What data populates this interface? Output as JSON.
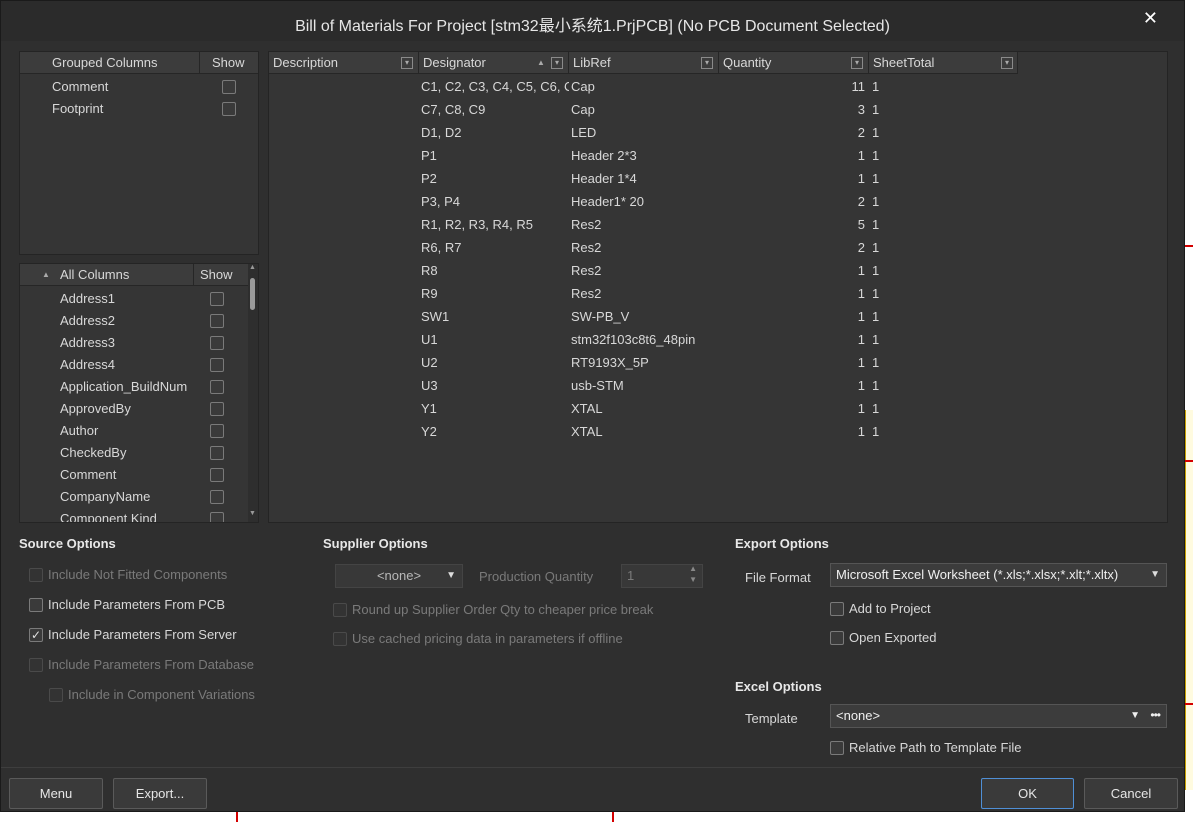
{
  "dialog": {
    "title": "Bill of Materials For Project [stm32最小系统1.PrjPCB] (No PCB Document Selected)",
    "close_glyph": "✕"
  },
  "grouped_columns": {
    "header": {
      "name": "Grouped Columns",
      "show": "Show"
    },
    "items": [
      {
        "label": "Comment",
        "checked": false
      },
      {
        "label": "Footprint",
        "checked": false
      }
    ]
  },
  "all_columns": {
    "header": {
      "name": "All Columns",
      "show": "Show"
    },
    "items": [
      {
        "label": "Address1",
        "checked": false
      },
      {
        "label": "Address2",
        "checked": false
      },
      {
        "label": "Address3",
        "checked": false
      },
      {
        "label": "Address4",
        "checked": false
      },
      {
        "label": "Application_BuildNum",
        "checked": false
      },
      {
        "label": "ApprovedBy",
        "checked": false
      },
      {
        "label": "Author",
        "checked": false
      },
      {
        "label": "CheckedBy",
        "checked": false
      },
      {
        "label": "Comment",
        "checked": false
      },
      {
        "label": "CompanyName",
        "checked": false
      },
      {
        "label": "Component Kind",
        "checked": false
      }
    ]
  },
  "bom_grid": {
    "columns": [
      "Description",
      "Designator",
      "LibRef",
      "Quantity",
      "SheetTotal"
    ],
    "rows": [
      {
        "description": "",
        "designator": "C1, C2, C3, C4, C5, C6, C",
        "libref": "Cap",
        "quantity": "11",
        "sheettotal": "1"
      },
      {
        "description": "",
        "designator": "C7, C8, C9",
        "libref": "Cap",
        "quantity": "3",
        "sheettotal": "1"
      },
      {
        "description": "",
        "designator": "D1, D2",
        "libref": "LED",
        "quantity": "2",
        "sheettotal": "1"
      },
      {
        "description": "",
        "designator": "P1",
        "libref": "Header 2*3",
        "quantity": "1",
        "sheettotal": "1"
      },
      {
        "description": "",
        "designator": "P2",
        "libref": "Header 1*4",
        "quantity": "1",
        "sheettotal": "1"
      },
      {
        "description": "",
        "designator": "P3, P4",
        "libref": "Header1* 20",
        "quantity": "2",
        "sheettotal": "1"
      },
      {
        "description": "",
        "designator": "R1, R2, R3, R4, R5",
        "libref": "Res2",
        "quantity": "5",
        "sheettotal": "1"
      },
      {
        "description": "",
        "designator": "R6, R7",
        "libref": "Res2",
        "quantity": "2",
        "sheettotal": "1"
      },
      {
        "description": "",
        "designator": "R8",
        "libref": "Res2",
        "quantity": "1",
        "sheettotal": "1"
      },
      {
        "description": "",
        "designator": "R9",
        "libref": "Res2",
        "quantity": "1",
        "sheettotal": "1"
      },
      {
        "description": "",
        "designator": "SW1",
        "libref": "SW-PB_V",
        "quantity": "1",
        "sheettotal": "1"
      },
      {
        "description": "",
        "designator": "U1",
        "libref": "stm32f103c8t6_48pin",
        "quantity": "1",
        "sheettotal": "1"
      },
      {
        "description": "",
        "designator": "U2",
        "libref": "RT9193X_5P",
        "quantity": "1",
        "sheettotal": "1"
      },
      {
        "description": "",
        "designator": "U3",
        "libref": "usb-STM",
        "quantity": "1",
        "sheettotal": "1"
      },
      {
        "description": "",
        "designator": "Y1",
        "libref": "XTAL",
        "quantity": "1",
        "sheettotal": "1"
      },
      {
        "description": "",
        "designator": "Y2",
        "libref": "XTAL",
        "quantity": "1",
        "sheettotal": "1"
      }
    ]
  },
  "source_options": {
    "title": "Source Options",
    "items": [
      {
        "label": "Include Not Fitted Components",
        "checked": false,
        "enabled": false
      },
      {
        "label": "Include Parameters From PCB",
        "checked": false,
        "enabled": true
      },
      {
        "label": "Include Parameters From Server",
        "checked": true,
        "enabled": true
      },
      {
        "label": "Include Parameters From Database",
        "checked": false,
        "enabled": false
      },
      {
        "label": "Include in Component Variations",
        "checked": false,
        "enabled": false
      }
    ]
  },
  "supplier_options": {
    "title": "Supplier Options",
    "supplier_select": "<none>",
    "production_quantity_label": "Production Quantity",
    "production_quantity_value": "1",
    "round_up_label": "Round up Supplier Order Qty to cheaper price break",
    "cached_pricing_label": "Use cached pricing data in parameters if offline"
  },
  "export_options": {
    "title": "Export Options",
    "file_format_label": "File Format",
    "file_format_value": "Microsoft Excel Worksheet (*.xls;*.xlsx;*.xlt;*.xltx)",
    "add_to_project_label": "Add to Project",
    "open_exported_label": "Open Exported"
  },
  "excel_options": {
    "title": "Excel Options",
    "template_label": "Template",
    "template_value": "<none>",
    "relative_path_label": "Relative Path to Template File"
  },
  "buttons": {
    "menu": "Menu",
    "export": "Export...",
    "ok": "OK",
    "cancel": "Cancel"
  },
  "colors": {
    "dialog_bg": "#2f2f2f",
    "panel_bg": "#353535",
    "ok_border": "#4f8fd6"
  }
}
